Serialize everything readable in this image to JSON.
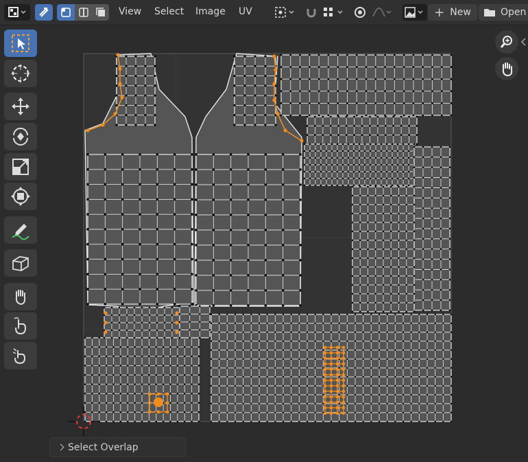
{
  "header": {
    "menus": [
      "View",
      "Select",
      "Image",
      "UV"
    ],
    "new_label": "New",
    "open_label": "Open"
  },
  "toolbar": {
    "tools": [
      "select-box",
      "cursor",
      "move",
      "rotate",
      "scale",
      "transform",
      "annotate",
      "rip-region",
      "grab",
      "relax",
      "pinch"
    ]
  },
  "operator_panel": {
    "label": "Select Overlap"
  },
  "colors": {
    "selected": "#f28c1c",
    "accent": "#4772b3",
    "mesh_face": "#555555",
    "background": "#2c2c2c"
  }
}
